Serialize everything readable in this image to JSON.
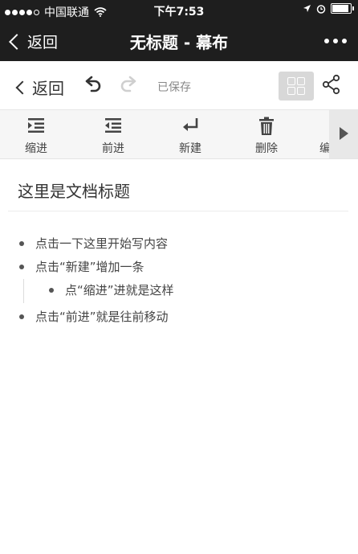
{
  "status_bar": {
    "carrier": "中国联通",
    "time": "下午7:53"
  },
  "nav_bar": {
    "back_label": "返回",
    "title": "无标题 - 幕布"
  },
  "app_toolbar": {
    "back_label": "返回",
    "saved_label": "已保存"
  },
  "edit_toolbar": {
    "tools": [
      {
        "label": "缩进",
        "icon": "indent-icon"
      },
      {
        "label": "前进",
        "icon": "outdent-icon"
      },
      {
        "label": "新建",
        "icon": "new-line-icon"
      },
      {
        "label": "删除",
        "icon": "trash-icon"
      },
      {
        "label": "编",
        "icon": "edit-icon"
      }
    ]
  },
  "document": {
    "title": "这里是文档标题",
    "items": [
      {
        "text": "点击一下这里开始写内容",
        "level": 0
      },
      {
        "text": "点击“新建”增加一条",
        "level": 0
      },
      {
        "text": "点“缩进”进就是这样",
        "level": 1
      },
      {
        "text": "点击“前进”就是往前移动",
        "level": 0
      }
    ]
  }
}
